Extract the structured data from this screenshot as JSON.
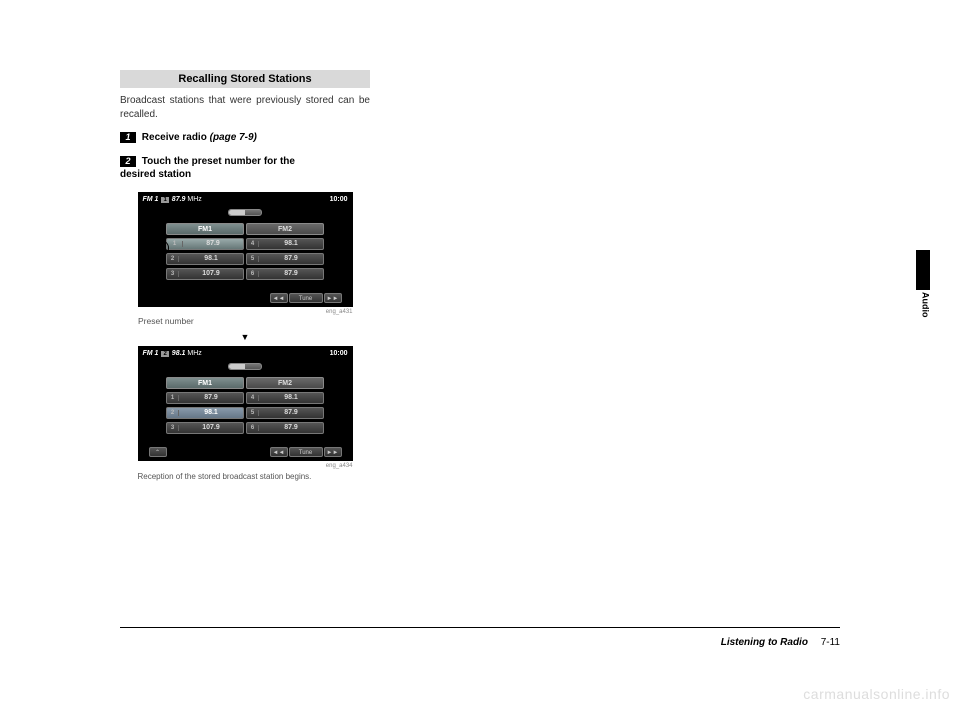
{
  "section_heading": "Recalling Stored Stations",
  "intro_text": "Broadcast stations that were previously stored can be recalled.",
  "steps": {
    "step1": {
      "num": "1",
      "label": "Receive radio",
      "ref": "(page 7-9)"
    },
    "step2": {
      "num": "2",
      "label_line1": "Touch the preset number for the",
      "label_line2": "desired station"
    }
  },
  "screen1": {
    "source": "FM 1",
    "preset_indicator": "1",
    "frequency": "87.9",
    "unit": "MHz",
    "clock": "10:00",
    "tabs": {
      "fm1": "FM1",
      "fm2": "FM2"
    },
    "presets": [
      {
        "num": "1",
        "freq": "87.9"
      },
      {
        "num": "4",
        "freq": "98.1"
      },
      {
        "num": "2",
        "freq": "98.1"
      },
      {
        "num": "5",
        "freq": "87.9"
      },
      {
        "num": "3",
        "freq": "107.9"
      },
      {
        "num": "6",
        "freq": "87.9"
      }
    ],
    "tune": {
      "prev": "◄◄",
      "label": "Tune",
      "next": "►►"
    },
    "img_id": "eng_a431",
    "callout": "Preset number"
  },
  "down_arrow": "▼",
  "screen2": {
    "source": "FM 1",
    "preset_indicator": "2",
    "frequency": "98.1",
    "unit": "MHz",
    "clock": "10:00",
    "tabs": {
      "fm1": "FM1",
      "fm2": "FM2"
    },
    "presets": [
      {
        "num": "1",
        "freq": "87.9"
      },
      {
        "num": "4",
        "freq": "98.1"
      },
      {
        "num": "2",
        "freq": "98.1"
      },
      {
        "num": "5",
        "freq": "87.9"
      },
      {
        "num": "3",
        "freq": "107.9"
      },
      {
        "num": "6",
        "freq": "87.9"
      }
    ],
    "updown": {
      "up": "⌃",
      "down": "⌄"
    },
    "tune": {
      "prev": "◄◄",
      "label": "Tune",
      "next": "►►"
    },
    "img_id": "eng_a434",
    "result_caption": "Reception of the stored broadcast station begins."
  },
  "sidetab": "Audio",
  "footer": {
    "section": "Listening to Radio",
    "page": "7-11"
  },
  "watermark": "carmanualsonline.info"
}
